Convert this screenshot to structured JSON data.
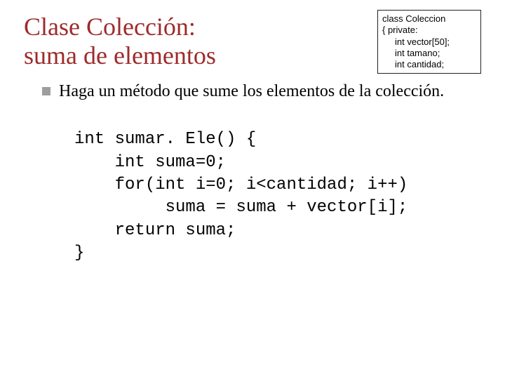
{
  "title_line1": "Clase Colección:",
  "title_line2": "suma de elementos",
  "class_box": {
    "l1": "class Coleccion",
    "l2": "{ private:",
    "l3": "int vector[50];",
    "l4": "int tamano;",
    "l5": "int cantidad;"
  },
  "bullet": "Haga un método que sume los elementos de la colección.",
  "code": "int sumar. Ele() {\n    int suma=0;\n    for(int i=0; i<cantidad; i++)\n         suma = suma + vector[i];\n    return suma;\n}"
}
